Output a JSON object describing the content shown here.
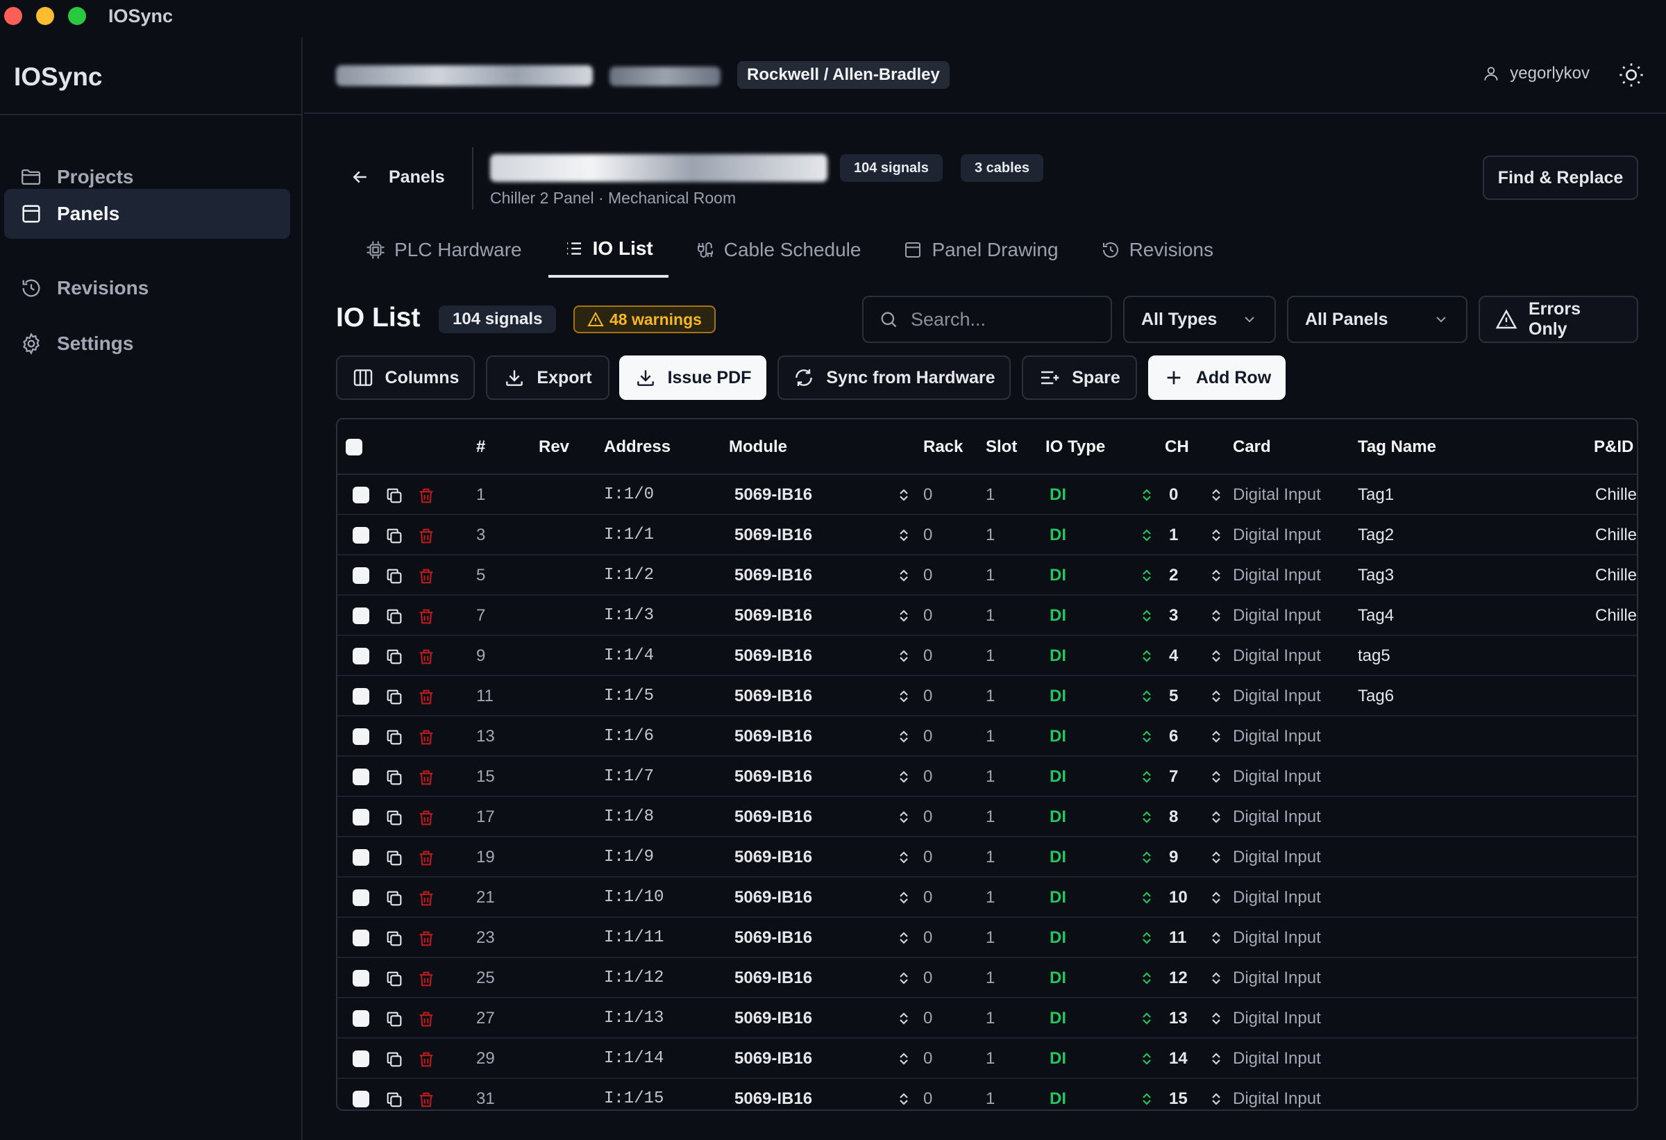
{
  "window": {
    "title": "IOSync"
  },
  "sidebar": {
    "brand": "IOSync",
    "items": [
      {
        "label": "Projects",
        "icon": "folder-icon"
      },
      {
        "label": "Panels",
        "icon": "panel-icon",
        "active": true
      },
      {
        "label": "Revisions",
        "icon": "history-icon"
      },
      {
        "label": "Settings",
        "icon": "gear-icon"
      }
    ]
  },
  "header": {
    "vendor": "Rockwell / Allen-Bradley",
    "user": "yegorlykov"
  },
  "panel": {
    "back_label": "Panels",
    "signals_badge": "104 signals",
    "cables_badge": "3 cables",
    "subtitle": "Chiller 2 Panel · Mechanical Room",
    "find_replace": "Find & Replace"
  },
  "tabs": [
    {
      "label": "PLC Hardware"
    },
    {
      "label": "IO List",
      "active": true
    },
    {
      "label": "Cable Schedule"
    },
    {
      "label": "Panel Drawing"
    },
    {
      "label": "Revisions"
    }
  ],
  "io": {
    "title": "IO List",
    "signals": "104 signals",
    "warnings": "48 warnings",
    "search_placeholder": "Search...",
    "type_filter": "All Types",
    "panel_filter": "All Panels",
    "errors_only": "Errors Only"
  },
  "toolbar": {
    "columns": "Columns",
    "export": "Export",
    "issue_pdf": "Issue PDF",
    "sync": "Sync from Hardware",
    "spare": "Spare",
    "add_row": "Add Row"
  },
  "table": {
    "headers": {
      "num": "#",
      "rev": "Rev",
      "address": "Address",
      "module": "Module",
      "rack": "Rack",
      "slot": "Slot",
      "io_type": "IO Type",
      "ch": "CH",
      "card": "Card",
      "tag": "Tag Name",
      "pid": "P&ID"
    },
    "rows": [
      {
        "num": "1",
        "address": "I:1/0",
        "module": "5069-IB16",
        "rack": "0",
        "slot": "1",
        "type": "DI",
        "ch": "0",
        "card": "Digital Input",
        "tag": "Tag1",
        "pid": "Chille"
      },
      {
        "num": "3",
        "address": "I:1/1",
        "module": "5069-IB16",
        "rack": "0",
        "slot": "1",
        "type": "DI",
        "ch": "1",
        "card": "Digital Input",
        "tag": "Tag2",
        "pid": "Chille"
      },
      {
        "num": "5",
        "address": "I:1/2",
        "module": "5069-IB16",
        "rack": "0",
        "slot": "1",
        "type": "DI",
        "ch": "2",
        "card": "Digital Input",
        "tag": "Tag3",
        "pid": "Chille"
      },
      {
        "num": "7",
        "address": "I:1/3",
        "module": "5069-IB16",
        "rack": "0",
        "slot": "1",
        "type": "DI",
        "ch": "3",
        "card": "Digital Input",
        "tag": "Tag4",
        "pid": "Chille"
      },
      {
        "num": "9",
        "address": "I:1/4",
        "module": "5069-IB16",
        "rack": "0",
        "slot": "1",
        "type": "DI",
        "ch": "4",
        "card": "Digital Input",
        "tag": "tag5",
        "pid": ""
      },
      {
        "num": "11",
        "address": "I:1/5",
        "module": "5069-IB16",
        "rack": "0",
        "slot": "1",
        "type": "DI",
        "ch": "5",
        "card": "Digital Input",
        "tag": "Tag6",
        "pid": ""
      },
      {
        "num": "13",
        "address": "I:1/6",
        "module": "5069-IB16",
        "rack": "0",
        "slot": "1",
        "type": "DI",
        "ch": "6",
        "card": "Digital Input",
        "tag": "",
        "pid": ""
      },
      {
        "num": "15",
        "address": "I:1/7",
        "module": "5069-IB16",
        "rack": "0",
        "slot": "1",
        "type": "DI",
        "ch": "7",
        "card": "Digital Input",
        "tag": "",
        "pid": ""
      },
      {
        "num": "17",
        "address": "I:1/8",
        "module": "5069-IB16",
        "rack": "0",
        "slot": "1",
        "type": "DI",
        "ch": "8",
        "card": "Digital Input",
        "tag": "",
        "pid": ""
      },
      {
        "num": "19",
        "address": "I:1/9",
        "module": "5069-IB16",
        "rack": "0",
        "slot": "1",
        "type": "DI",
        "ch": "9",
        "card": "Digital Input",
        "tag": "",
        "pid": ""
      },
      {
        "num": "21",
        "address": "I:1/10",
        "module": "5069-IB16",
        "rack": "0",
        "slot": "1",
        "type": "DI",
        "ch": "10",
        "card": "Digital Input",
        "tag": "",
        "pid": ""
      },
      {
        "num": "23",
        "address": "I:1/11",
        "module": "5069-IB16",
        "rack": "0",
        "slot": "1",
        "type": "DI",
        "ch": "11",
        "card": "Digital Input",
        "tag": "",
        "pid": ""
      },
      {
        "num": "25",
        "address": "I:1/12",
        "module": "5069-IB16",
        "rack": "0",
        "slot": "1",
        "type": "DI",
        "ch": "12",
        "card": "Digital Input",
        "tag": "",
        "pid": ""
      },
      {
        "num": "27",
        "address": "I:1/13",
        "module": "5069-IB16",
        "rack": "0",
        "slot": "1",
        "type": "DI",
        "ch": "13",
        "card": "Digital Input",
        "tag": "",
        "pid": ""
      },
      {
        "num": "29",
        "address": "I:1/14",
        "module": "5069-IB16",
        "rack": "0",
        "slot": "1",
        "type": "DI",
        "ch": "14",
        "card": "Digital Input",
        "tag": "",
        "pid": ""
      },
      {
        "num": "31",
        "address": "I:1/15",
        "module": "5069-IB16",
        "rack": "0",
        "slot": "1",
        "type": "DI",
        "ch": "15",
        "card": "Digital Input",
        "tag": "",
        "pid": ""
      }
    ]
  },
  "colors": {
    "accent": "#22c55e",
    "warning": "#f5b724",
    "danger": "#b91c1c",
    "background": "#0c0e16"
  }
}
